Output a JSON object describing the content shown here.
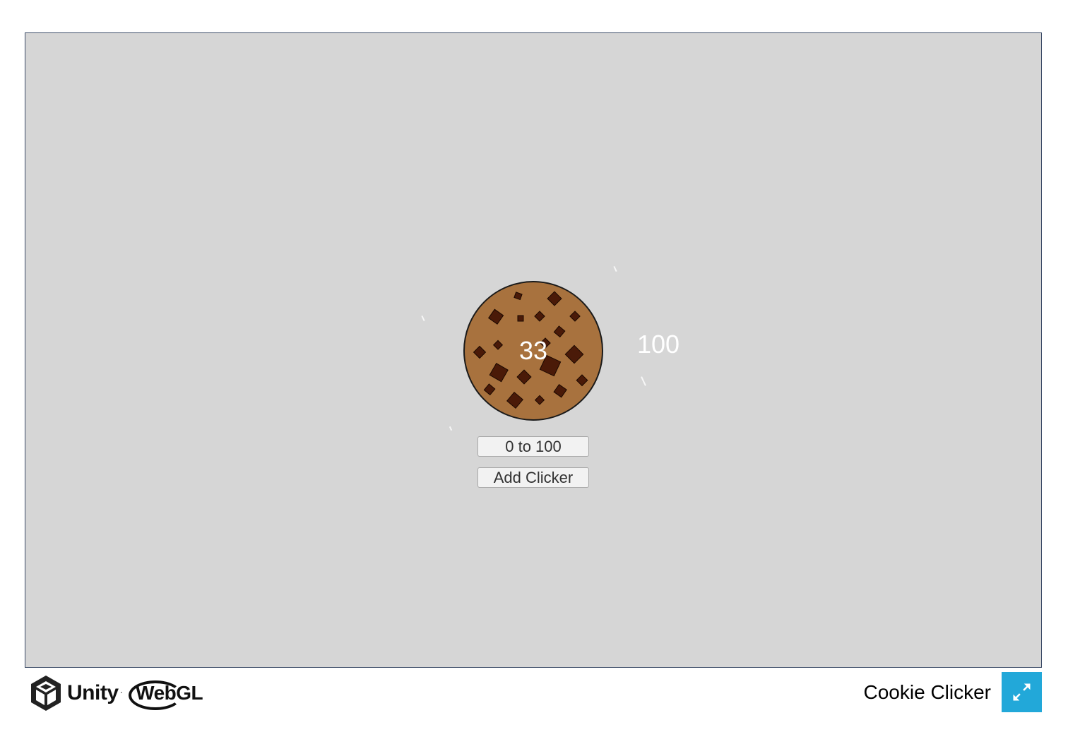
{
  "game": {
    "cookie_count": "33",
    "target_value": "100",
    "range_button_label": "0 to 100",
    "add_clicker_label": "Add Clicker"
  },
  "footer": {
    "unity_logo_text": "Unity",
    "webgl_logo_text": "WebGL",
    "build_title": "Cookie Clicker",
    "fullscreen_icon": "fullscreen-icon"
  },
  "colors": {
    "canvas_bg": "#d6d6d6",
    "cookie_dough": "#a8723e",
    "chocolate_chip": "#4a1a08",
    "fullscreen_button": "#22a8d9"
  }
}
